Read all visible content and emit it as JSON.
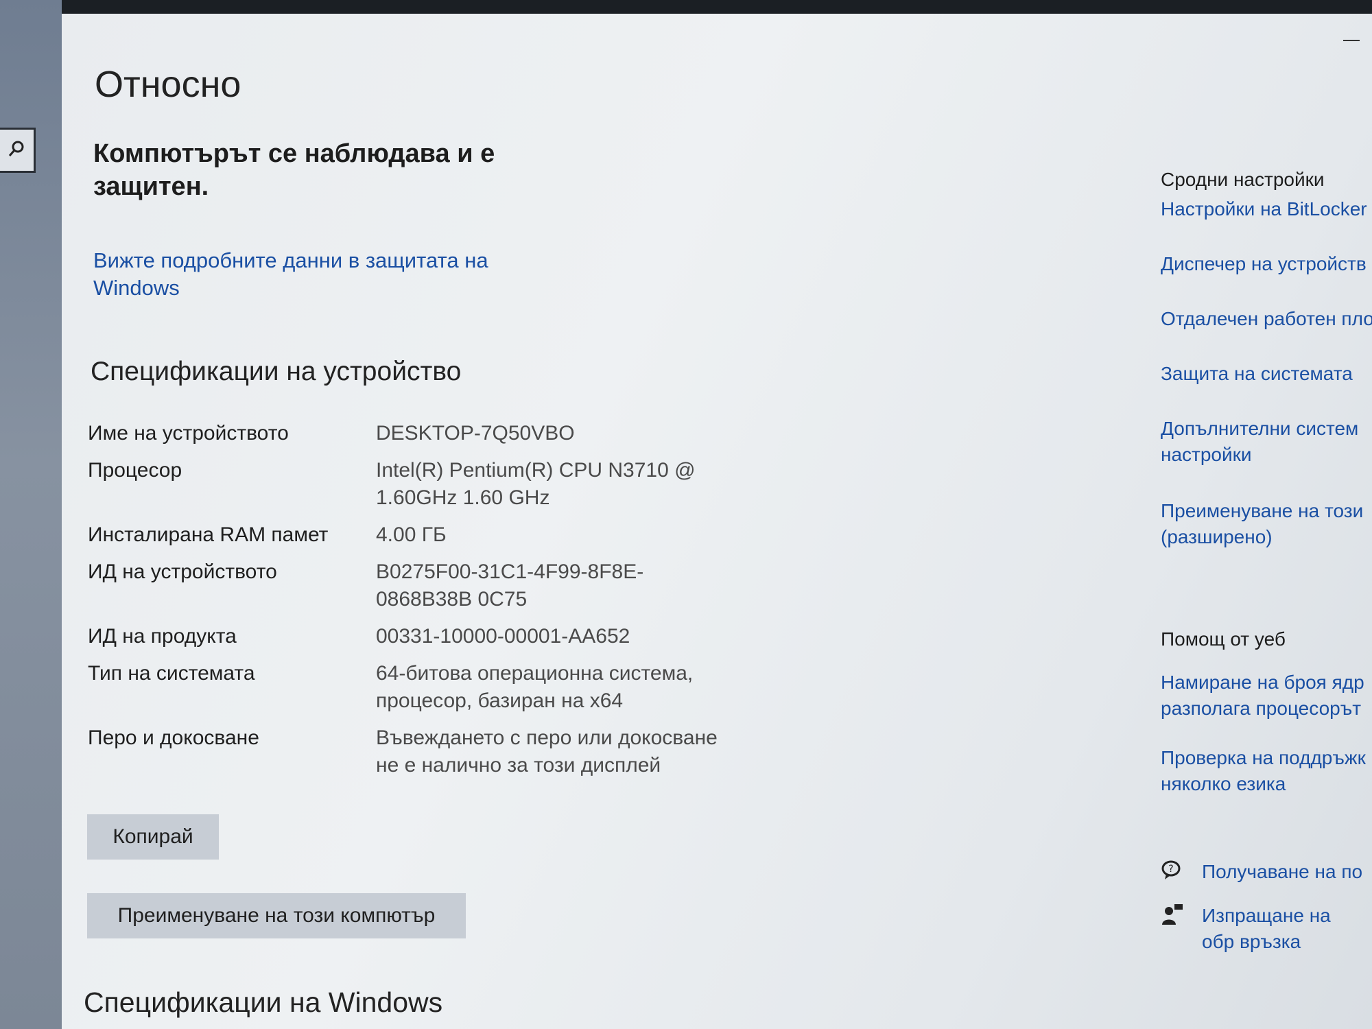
{
  "page": {
    "title": "Относно",
    "status": "Компютърът се наблюдава и е защитен.",
    "details_link": "Вижте подробните данни в защитата на Windows",
    "specs_title": "Спецификации на устройство",
    "copy_button": "Копирай",
    "rename_button": "Преименуване на този компютър",
    "windows_specs_title": "Спецификации на Windows"
  },
  "specs": [
    {
      "label": "Име на устройството",
      "value": "DESKTOP-7Q50VBO"
    },
    {
      "label": "Процесор",
      "value": "Intel(R) Pentium(R) CPU  N3710  @ 1.60GHz   1.60 GHz"
    },
    {
      "label": "Инсталирана RAM памет",
      "value": "4.00 ГБ"
    },
    {
      "label": "ИД на устройството",
      "value": "B0275F00-31C1-4F99-8F8E-0868B38B 0C75"
    },
    {
      "label": "ИД на продукта",
      "value": "00331-10000-00001-AA652"
    },
    {
      "label": "Тип на системата",
      "value": "64-битова операционна система, процесор, базиран на x64"
    },
    {
      "label": "Перо и докосване",
      "value": "Въвеждането с перо или докосване не е налично за този дисплей"
    }
  ],
  "sidebar": {
    "related_title": "Сродни настройки",
    "related_links": [
      "Настройки на BitLocker",
      "Диспечер на устройств",
      "Отдалечен работен пло",
      "Защита на системата",
      "Допълнителни систем настройки",
      "Преименуване на този (разширено)"
    ],
    "help_title": "Помощ от уеб",
    "help_links": [
      "Намиране на броя ядр разполага процесорът",
      "Проверка на поддръжк няколко езика"
    ],
    "action_links": [
      {
        "label": "Получаване на по",
        "icon": "help-chat-icon"
      },
      {
        "label": "Изпращане на обр връзка",
        "icon": "feedback-person-icon"
      }
    ]
  }
}
